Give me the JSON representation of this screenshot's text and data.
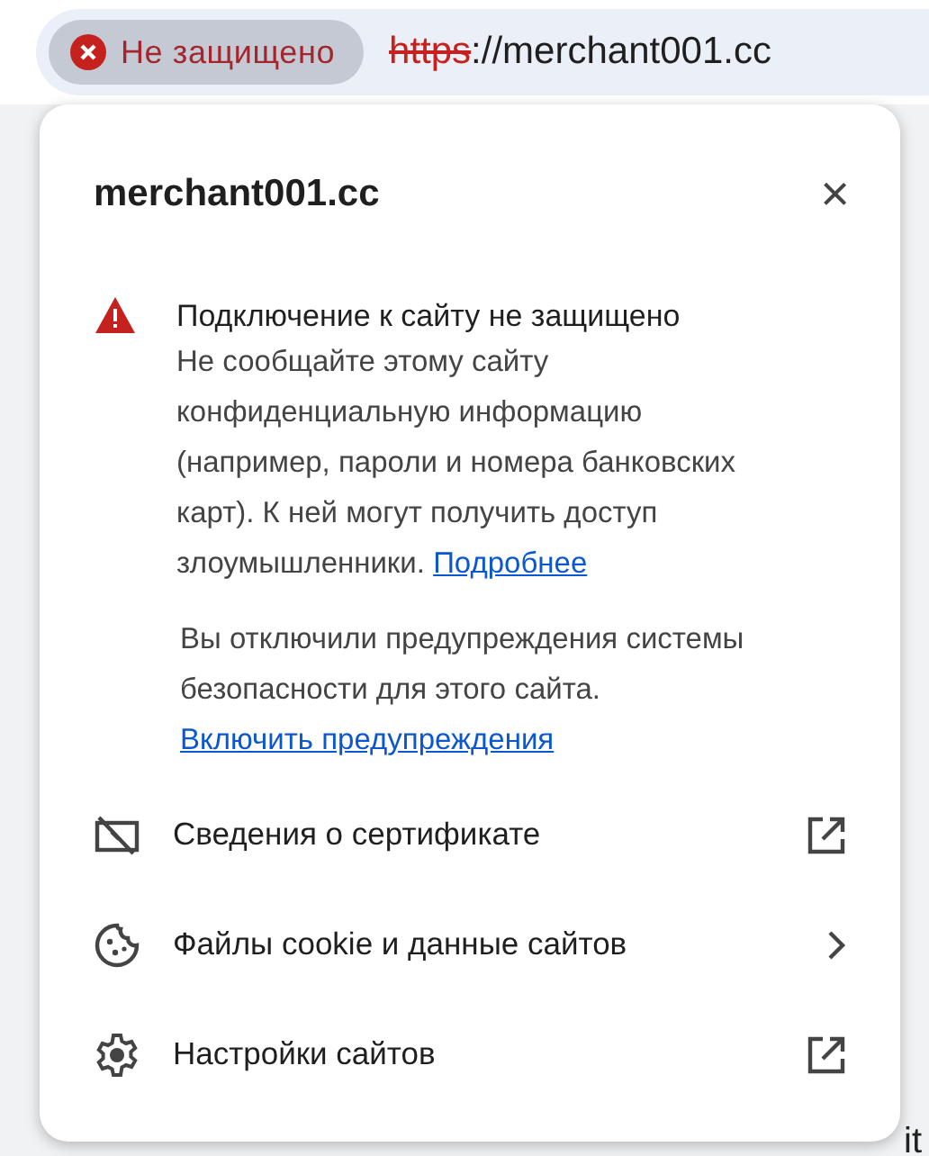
{
  "address_bar": {
    "security_chip": "Не защищено",
    "scheme": "https",
    "rest": "://merchant001.cc"
  },
  "popup": {
    "title": "merchant001.cc",
    "close": "×",
    "warning": {
      "heading": "Подключение к сайту не защищено",
      "text": "Не сообщайте этому сайту конфиденциальную информацию (например, пароли и номера банковских карт). К ней могут получить доступ злоумышленники.",
      "link": "Подробнее"
    },
    "notice": {
      "text": "Вы отключили предупреждения системы безопасности для этого сайта.",
      "link": "Включить предупреждения"
    },
    "items": [
      {
        "kind": "certificate",
        "label": "Сведения о сертификате",
        "opens_externally": true
      },
      {
        "kind": "cookie",
        "label": "Файлы cookie и данные сайтов",
        "opens_externally": false
      },
      {
        "kind": "settings",
        "label": "Настройки сайтов",
        "opens_externally": true
      }
    ]
  },
  "page_fragment": "it"
}
